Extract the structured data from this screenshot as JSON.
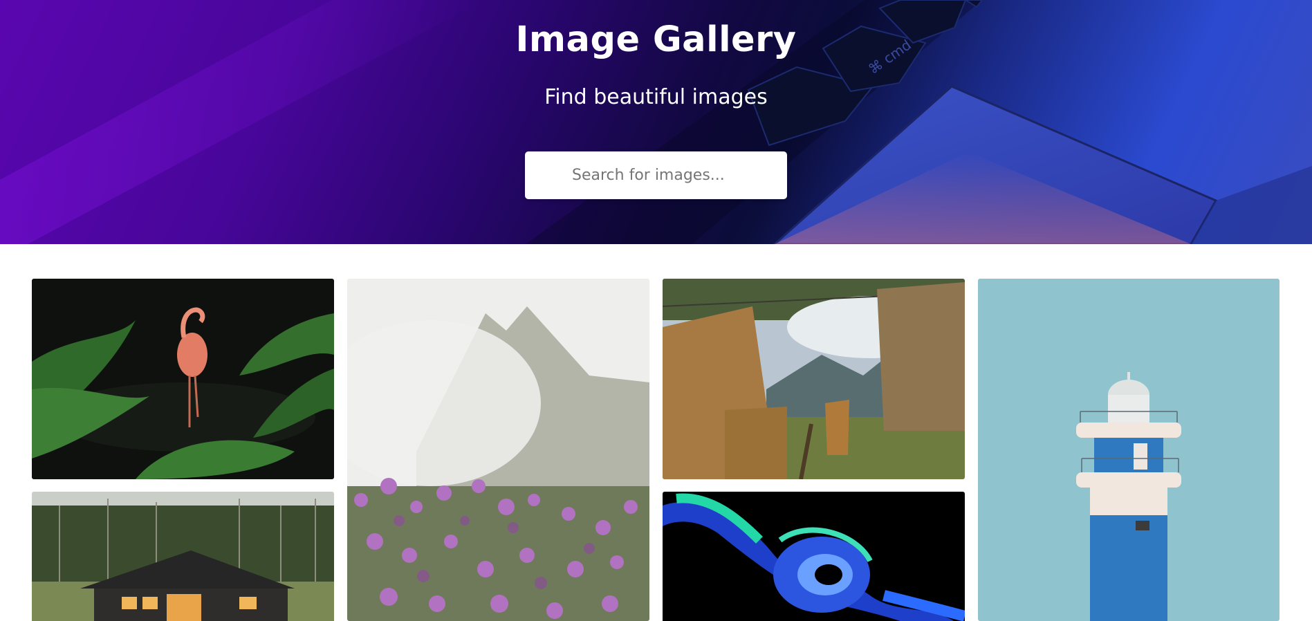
{
  "header": {
    "title": "Image Gallery",
    "subtitle": "Find beautiful images"
  },
  "search": {
    "placeholder": "Search for images..."
  },
  "gallery": {
    "images": [
      {
        "subject": "flamingo"
      },
      {
        "subject": "misty-mountain-flowers"
      },
      {
        "subject": "laundry-line"
      },
      {
        "subject": "lighthouse"
      },
      {
        "subject": "cabin"
      },
      {
        "subject": "blue-swirl"
      }
    ]
  },
  "colors": {
    "hero_purple": "#5a06b0",
    "hero_dark": "#0b0d3a",
    "hero_blue": "#2b4ad0",
    "page_background": "#ffffff"
  }
}
